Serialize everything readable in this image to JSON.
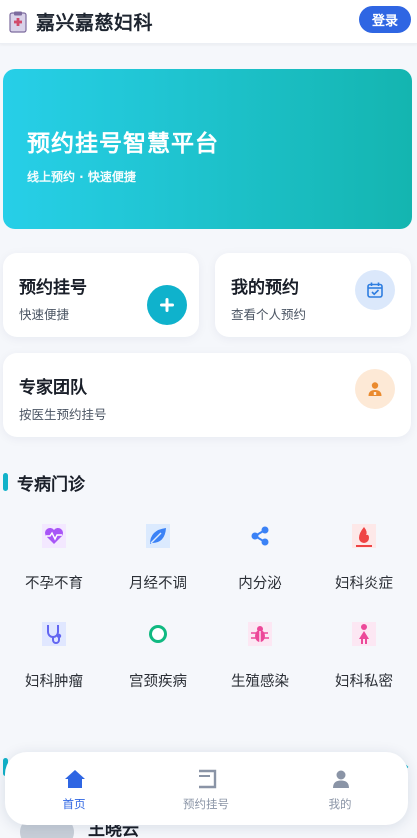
{
  "header": {
    "logo_icon": "hospital-logo-icon",
    "title": "嘉兴嘉慈妇科",
    "login_label": "登录"
  },
  "banner": {
    "title": "预约挂号智慧平台",
    "subtitle": "线上预约 · 快速便捷",
    "gradient": [
      "#27cfe8",
      "#14b5b0"
    ]
  },
  "cards": {
    "book": {
      "title": "预约挂号",
      "subtitle": "快速便捷",
      "icon": "plus-icon"
    },
    "mine": {
      "title": "我的预约",
      "subtitle": "查看个人预约",
      "icon": "calendar-check-icon"
    },
    "team": {
      "title": "专家团队",
      "subtitle": "按医生预约挂号",
      "icon": "doctor-icon"
    }
  },
  "specialties": {
    "title": "专病门诊",
    "items": [
      {
        "label": "不孕不育",
        "icon": "heartbeat-icon",
        "color": "#a855f7"
      },
      {
        "label": "月经不调",
        "icon": "leaf-icon",
        "color": "#3b82f6"
      },
      {
        "label": "内分泌",
        "icon": "share-nodes-icon",
        "color": "#3b82f6"
      },
      {
        "label": "妇科炎症",
        "icon": "fire-icon",
        "color": "#ef4444"
      },
      {
        "label": "妇科肿瘤",
        "icon": "stethoscope-icon",
        "color": "#6366f1"
      },
      {
        "label": "宫颈疾病",
        "icon": "circle-ring-icon",
        "color": "#10b981"
      },
      {
        "label": "生殖感染",
        "icon": "bug-icon",
        "color": "#ec4899"
      },
      {
        "label": "妇科私密",
        "icon": "female-icon",
        "color": "#ec4899"
      }
    ]
  },
  "peek": {
    "name": "王晓云"
  },
  "tabbar": {
    "tabs": [
      {
        "label": "首页",
        "icon": "home-icon",
        "active": true
      },
      {
        "label": "预约挂号",
        "icon": "register-icon",
        "active": false
      },
      {
        "label": "我的",
        "icon": "user-icon",
        "active": false
      }
    ],
    "active_color": "#2f66e3"
  }
}
